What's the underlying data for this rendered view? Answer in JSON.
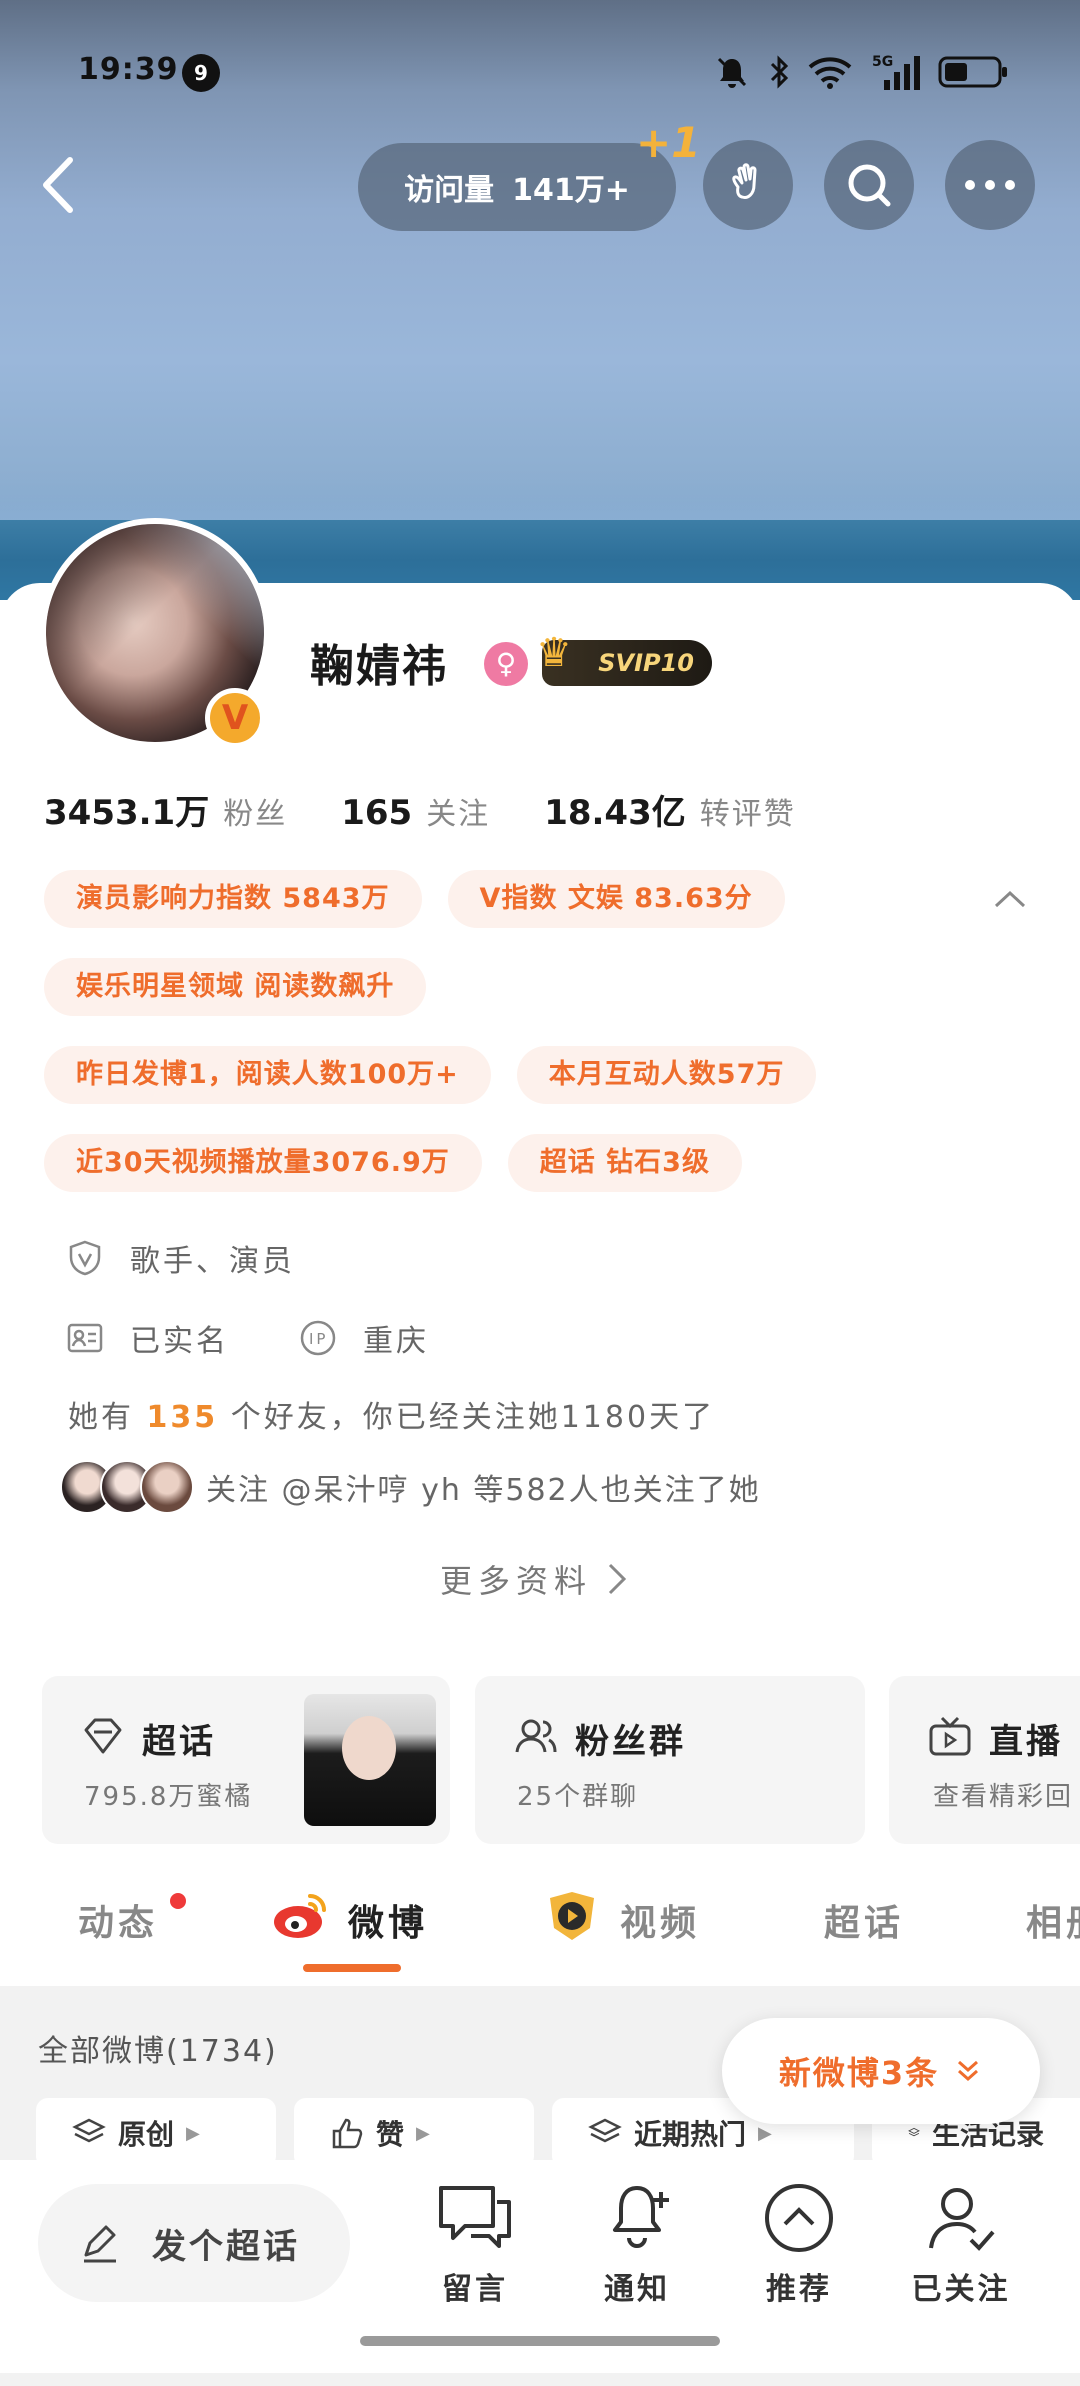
{
  "status_bar": {
    "time": "19:39",
    "notification_count": "9",
    "network": "5G",
    "icons": [
      "mute-icon",
      "bluetooth-icon",
      "wifi-icon",
      "signal-icon",
      "battery-icon"
    ]
  },
  "top_nav": {
    "visit_label": "访问量",
    "visit_value": "141万+",
    "plus_one": "+1",
    "buttons": [
      "back-icon",
      "wave-hand-icon",
      "search-icon",
      "more-icon"
    ]
  },
  "profile": {
    "name": "鞠婧祎",
    "gender_symbol": "♀",
    "vip_badge": "SVIP10",
    "verified_mark": "V",
    "stats": [
      {
        "value": "3453.1万",
        "label": "粉丝"
      },
      {
        "value": "165",
        "label": "关注"
      },
      {
        "value": "18.43亿",
        "label": "转评赞"
      }
    ]
  },
  "tags": [
    [
      "演员影响力指数 5843万",
      "V指数 文娱 83.63分"
    ],
    [
      "娱乐明星领域 阅读数飙升"
    ],
    [
      "昨日发博1，阅读人数100万+",
      "本月互动人数57万"
    ],
    [
      "近30天视频播放量3076.9万",
      "超话 钻石3级"
    ]
  ],
  "info": {
    "occupation": "歌手、演员",
    "verified_name": "已实名",
    "ip_location": "重庆",
    "friends_prefix": "她有",
    "friends_count": "135",
    "friends_suffix": "个好友，你已经关注她1180天了",
    "mutual_followers": "关注 @呆汁哼 yh 等582人也关注了她",
    "more_info": "更多资料"
  },
  "feature_cards": [
    {
      "title": "超话",
      "sub": "795.8万蜜橘",
      "icon": "diamond-icon"
    },
    {
      "title": "粉丝群",
      "sub": "25个群聊",
      "icon": "group-icon"
    },
    {
      "title": "直播",
      "sub": "查看精彩回",
      "icon": "tv-icon"
    }
  ],
  "tabs": {
    "items": [
      "动态",
      "微博",
      "视频",
      "超话",
      "相册"
    ],
    "active": "微博"
  },
  "feed": {
    "count_label": "全部微博(1734)",
    "filters": [
      "原创",
      "赞",
      "近期热门",
      "生活记录"
    ],
    "new_posts": "新微博3条"
  },
  "bottom_bar": {
    "post_placeholder": "发个超话",
    "items": [
      {
        "label": "留言",
        "icon": "message-icon"
      },
      {
        "label": "通知",
        "icon": "bell-plus-icon"
      },
      {
        "label": "推荐",
        "icon": "recommend-icon"
      },
      {
        "label": "已关注",
        "icon": "followed-user-icon"
      }
    ]
  },
  "colors": {
    "accent": "#ef6d2c",
    "tag_bg": "#fdf1ec",
    "gender": "#ef7aa3",
    "svip_gold": "#f7d57b"
  }
}
